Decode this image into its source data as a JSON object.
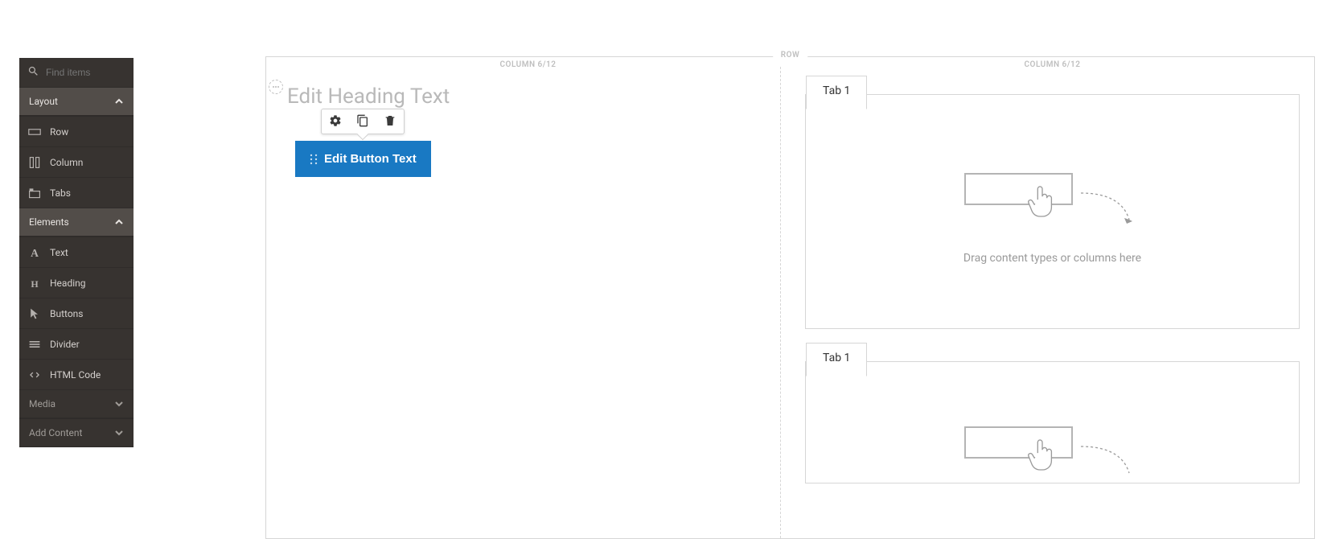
{
  "search": {
    "placeholder": "Find items"
  },
  "panel": {
    "sections": [
      {
        "label": "Layout",
        "collapsed": false
      },
      {
        "label": "Elements",
        "collapsed": false
      },
      {
        "label": "Media",
        "collapsed": true
      },
      {
        "label": "Add Content",
        "collapsed": true
      }
    ],
    "layout_items": [
      {
        "label": "Row"
      },
      {
        "label": "Column"
      },
      {
        "label": "Tabs"
      }
    ],
    "element_items": [
      {
        "label": "Text"
      },
      {
        "label": "Heading"
      },
      {
        "label": "Buttons"
      },
      {
        "label": "Divider"
      },
      {
        "label": "HTML Code"
      }
    ]
  },
  "canvas": {
    "row_label": "ROW",
    "columns": [
      {
        "label": "COLUMN 6/12"
      },
      {
        "label": "COLUMN 6/12"
      }
    ],
    "heading_placeholder": "Edit Heading Text",
    "button_text": "Edit Button Text",
    "tabs": [
      {
        "label": "Tab 1"
      },
      {
        "label": "Tab 1"
      }
    ],
    "drop_hint": "Drag content types or columns here"
  }
}
